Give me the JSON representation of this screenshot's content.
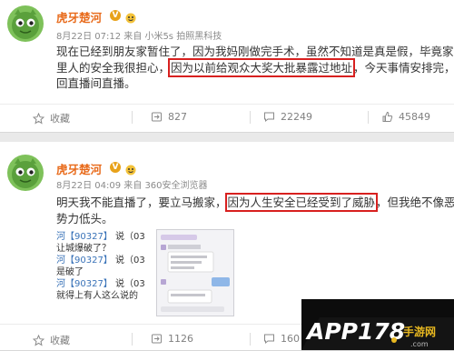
{
  "posts": [
    {
      "username": "虎牙楚河",
      "vip_badge": "V",
      "meta": "8月22日 07:12 来自 小米5s 拍照黑科技",
      "lines": [
        {
          "pre": "现在已经到朋友家暂住了，因为我妈刚做完手术，虽然不知道是真是假，毕竟家",
          "hl": "",
          "post": ""
        },
        {
          "pre": "里人的安全我很担心，",
          "hl": "因为以前给观众大奖大批暴露过地址",
          "post": "，今天事情安排完，"
        },
        {
          "pre": "回直播间直播。",
          "hl": "",
          "post": ""
        }
      ],
      "actions": {
        "favorite": "收藏",
        "repost": "827",
        "comment": "22249",
        "like": "45849"
      }
    },
    {
      "username": "虎牙楚河",
      "vip_badge": "V",
      "meta": "8月22日 04:09 来自 360安全浏览器",
      "lines": [
        {
          "pre": "明天我不能直播了，要立马搬家，",
          "hl": "因为人生安全已经受到了威胁",
          "post": "，但我绝不像恶"
        },
        {
          "pre": "势力低头。",
          "hl": "",
          "post": ""
        }
      ],
      "quote_lines": [
        {
          "name": "河【90327】",
          "text": "说（03"
        },
        {
          "name": "",
          "text": "让城爆破了？"
        },
        {
          "name": "河【90327】",
          "text": "说（03"
        },
        {
          "name": "",
          "text": "是破了"
        },
        {
          "name": "河【90327】",
          "text": "说（03"
        },
        {
          "name": "",
          "text": "就得上有人这么说的"
        }
      ],
      "actions": {
        "favorite": "收藏",
        "repost": "1126",
        "comment": "160"
      }
    }
  ],
  "watermark": {
    "text": "APP178",
    "suffix": "手游网",
    "domain": ".com"
  },
  "colors": {
    "username": "#e86a1a",
    "highlight_border": "#d8201f",
    "quote_name": "#3a73b8"
  }
}
